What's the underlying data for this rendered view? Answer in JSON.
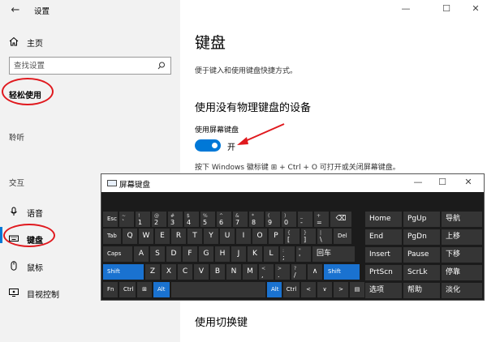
{
  "window": {
    "title": "设置",
    "back": "←",
    "min": "—",
    "max": "☐",
    "close": "✕"
  },
  "sidebar": {
    "home": "主页",
    "search_placeholder": "查找设置",
    "category": "轻松使用",
    "group_vision": "聆听",
    "group_interaction": "交互",
    "items": [
      {
        "label": "语音"
      },
      {
        "label": "键盘"
      },
      {
        "label": "鼠标"
      },
      {
        "label": "目视控制"
      }
    ]
  },
  "main": {
    "title": "键盘",
    "desc": "便于键入和使用键盘快捷方式。",
    "section1": "使用没有物理键盘的设备",
    "toggle_label": "使用屏幕键盘",
    "toggle_state": "开",
    "toggle_on": true,
    "hint": "按下 Windows 徽标键 ⊞ + Ctrl + O 可打开或关闭屏幕键盘。",
    "section2": "使用切换键"
  },
  "osk": {
    "title": "屏幕键盘",
    "min": "—",
    "max": "☐",
    "close": "✕",
    "row1": [
      "Esc",
      "~\n`",
      "!\n1",
      "@\n2",
      "#\n3",
      "$\n4",
      "%\n5",
      "^\n6",
      "&\n7",
      "*\n8",
      "(\n9",
      ")\n0",
      "_\n-",
      "+\n=",
      "⌫"
    ],
    "row2": [
      "Tab",
      "Q",
      "W",
      "E",
      "R",
      "T",
      "Y",
      "U",
      "I",
      "O",
      "P",
      "{\n[",
      "}\n]",
      "|\n\\",
      "Del"
    ],
    "row3": [
      "Caps",
      "A",
      "S",
      "D",
      "F",
      "G",
      "H",
      "J",
      "K",
      "L",
      ":\n;",
      "\"\n'",
      "回车"
    ],
    "row4": [
      "Shift",
      "Z",
      "X",
      "C",
      "V",
      "B",
      "N",
      "M",
      "<\n,",
      ">\n.",
      "?\n/",
      "∧",
      "Shift"
    ],
    "row5": [
      "Fn",
      "Ctrl",
      "⊞",
      "Alt",
      "",
      "Alt",
      "Ctrl",
      "<",
      "∨",
      ">",
      "▤"
    ],
    "nav": [
      [
        "Home",
        "PgUp",
        "导航"
      ],
      [
        "End",
        "PgDn",
        "上移"
      ],
      [
        "Insert",
        "Pause",
        "下移"
      ],
      [
        "PrtScn",
        "ScrLk",
        "停靠"
      ],
      [
        "选项",
        "帮助",
        "淡化"
      ]
    ]
  },
  "colors": {
    "accent": "#0078d7",
    "annotation": "#e0191e",
    "osk_key": "#353535",
    "osk_bg": "#1b1b1b"
  }
}
